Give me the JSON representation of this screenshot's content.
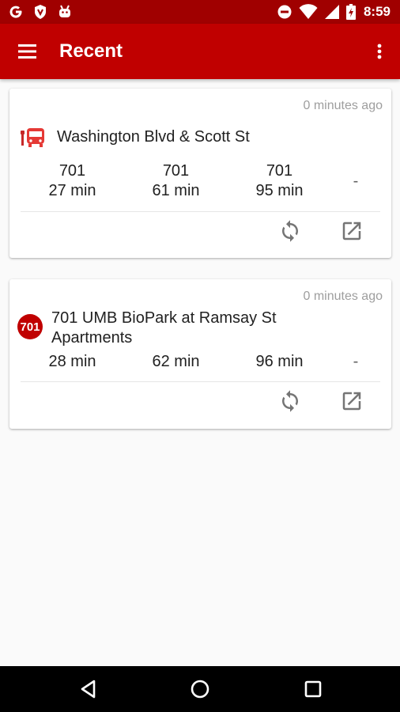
{
  "status_bar": {
    "time": "8:59",
    "icons": [
      "google-icon",
      "shield-icon",
      "android-icon",
      "do-not-disturb-icon",
      "wifi-icon",
      "signal-icon",
      "battery-icon"
    ]
  },
  "app_bar": {
    "title": "Recent",
    "background": "#c00000"
  },
  "cards": [
    {
      "timestamp": "0 minutes ago",
      "icon": "bus-stop-icon",
      "stop_name": "Washington Blvd & Scott St",
      "arrivals": [
        {
          "route": "701",
          "time": "27 min"
        },
        {
          "route": "701",
          "time": "61 min"
        },
        {
          "route": "701",
          "time": "95 min"
        }
      ],
      "empty": "-",
      "actions": [
        "refresh-icon",
        "open-external-icon"
      ]
    },
    {
      "timestamp": "0 minutes ago",
      "route_badge": "701",
      "stop_name_line1": "701 UMB BioPark at Ramsay St",
      "stop_name_line2": "Apartments",
      "arrivals": [
        {
          "time": "28 min"
        },
        {
          "time": "62 min"
        },
        {
          "time": "96 min"
        }
      ],
      "empty": "-",
      "actions": [
        "refresh-icon",
        "open-external-icon"
      ]
    }
  ],
  "navigation": [
    "back-icon",
    "home-icon",
    "recents-icon"
  ]
}
